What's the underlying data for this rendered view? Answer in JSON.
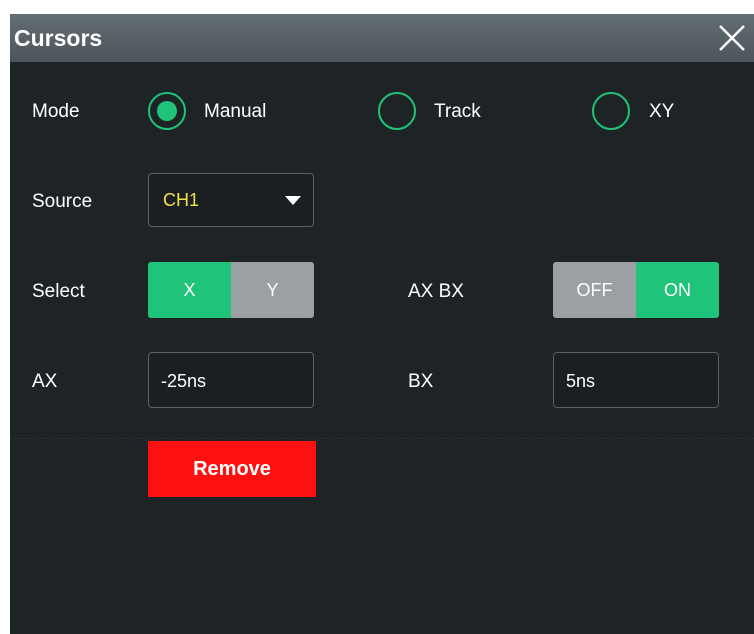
{
  "dialog": {
    "title": "Cursors",
    "close_icon": "close-icon"
  },
  "mode": {
    "label": "Mode",
    "options": [
      {
        "label": "Manual",
        "selected": true
      },
      {
        "label": "Track",
        "selected": false
      },
      {
        "label": "XY",
        "selected": false
      }
    ]
  },
  "source": {
    "label": "Source",
    "value": "CH1",
    "icon": "caret-down-icon"
  },
  "select": {
    "label": "Select",
    "options": [
      "X",
      "Y"
    ],
    "selected": "X"
  },
  "axbx": {
    "label": "AX BX",
    "options": [
      "OFF",
      "ON"
    ],
    "selected": "ON"
  },
  "ax": {
    "label": "AX",
    "value": "-25ns"
  },
  "bx": {
    "label": "BX",
    "value": "5ns"
  },
  "remove_button": {
    "label": "Remove"
  },
  "colors": {
    "accent": "#1fc47a",
    "source_text": "#f2e14c",
    "danger": "#ff1010",
    "background": "#1e2326",
    "titlebar": "#566066"
  }
}
